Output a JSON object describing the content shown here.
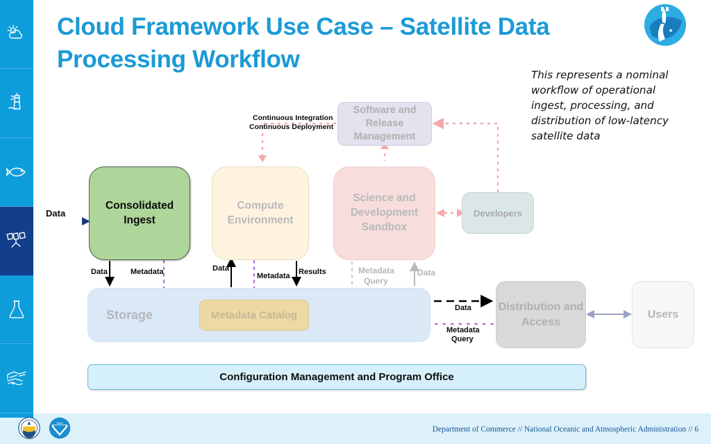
{
  "slide": {
    "title": "Cloud Framework Use Case – Satellite Data Processing Workflow",
    "caption": "This represents a nominal workflow of operational ingest, processing, and distribution of low-latency satellite data"
  },
  "sidebar": {
    "items": [
      {
        "name": "weather-icon",
        "label": "Weather"
      },
      {
        "name": "lighthouse-icon",
        "label": "Coasts"
      },
      {
        "name": "fish-icon",
        "label": "Fisheries"
      },
      {
        "name": "satellite-icon",
        "label": "Satellites",
        "active": true
      },
      {
        "name": "flask-icon",
        "label": "Research"
      },
      {
        "name": "charting-icon",
        "label": "Charting"
      }
    ]
  },
  "diagram": {
    "nodes": {
      "consolidated_ingest": "Consolidated Ingest",
      "compute_environment": "Compute Environment",
      "science_sandbox": "Science and Development Sandbox",
      "developers": "Developers",
      "software_release": "Software and Release Management",
      "storage": "Storage",
      "metadata_catalog": "Metadata Catalog",
      "distribution": "Distribution and Access",
      "users": "Users",
      "config_mgmt": "Configuration Management and Program Office"
    },
    "edge_labels": {
      "data_in": "Data",
      "ingest_data": "Data",
      "ingest_metadata": "Metadata",
      "compute_data": "Data",
      "compute_metadata": "Metadata",
      "compute_results": "Results",
      "sandbox_metadata_query_l1": "Metadata",
      "sandbox_metadata_query_l2": "Query",
      "sandbox_data": "Data",
      "ci_cd_l1": "Continuous Integration",
      "ci_cd_l2": "Continuous Deployment",
      "dist_data": "Data",
      "dist_metadata_l1": "Metadata",
      "dist_metadata_l2": "Query"
    },
    "colors": {
      "ingest": "#aed59a",
      "compute": "#fdf3df",
      "sandbox": "#f7dedd",
      "developers": "#dbe6e8",
      "software_release": "#e4e2ee",
      "storage": "#dbe9f7",
      "catalog": "#ecd9a4",
      "distribution": "#d9d9d9",
      "users": "#f7f7f7",
      "config": "#d6f0fb",
      "data_arrow": "#000000",
      "metadata_arrow": "#a33fd1",
      "pink_arrow": "#f4a9a9",
      "users_arrow": "#9aa0c4",
      "brand": "#1b9ad6"
    }
  },
  "footer": {
    "org1": "Department of Commerce",
    "sep": "//",
    "org2": "National Oceanic and Atmospheric Administration",
    "page": "6"
  }
}
